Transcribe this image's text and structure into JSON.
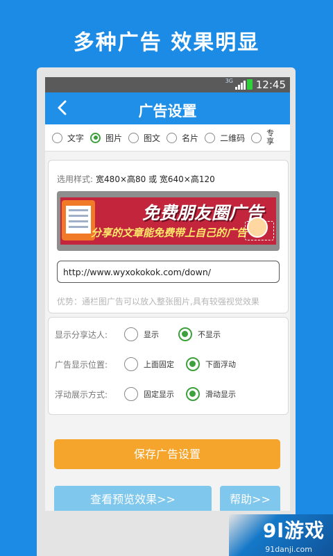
{
  "promo": {
    "title": "多种广告  效果明显"
  },
  "statusbar": {
    "network": "3G",
    "time": "12:45",
    "battery_color": "#2fd13a"
  },
  "appbar": {
    "title": "广告设置"
  },
  "ad_types": [
    {
      "label": "文字",
      "selected": false
    },
    {
      "label": "图片",
      "selected": true
    },
    {
      "label": "图文",
      "selected": false
    },
    {
      "label": "名片",
      "selected": false
    },
    {
      "label": "二维码",
      "selected": false
    },
    {
      "label": "专享",
      "selected": false
    }
  ],
  "image_card": {
    "style_label": "选用样式:",
    "style_value": "宽480×高80 或 宽640×高120",
    "banner_title": "免费朋友圈广告",
    "banner_subtitle": "分享的文章能免费带上自己的广告",
    "url_value": "http://www.wyxokokok.com/down/",
    "hint": "优势：通栏图广告可以放入整张图片,具有较强视觉效果"
  },
  "display_options": [
    {
      "label": "显示分享达人:",
      "options": [
        "显示",
        "不显示"
      ],
      "selected": 1
    },
    {
      "label": "广告显示位置:",
      "options": [
        "上面固定",
        "下面浮动"
      ],
      "selected": 1
    },
    {
      "label": "浮动展示方式:",
      "options": [
        "固定显示",
        "滑动显示"
      ],
      "selected": 1
    }
  ],
  "buttons": {
    "save": "保存广告设置",
    "preview": "查看预览效果>>",
    "help": "帮助>>"
  },
  "watermark": {
    "logo": "9l游戏",
    "url": "91danji.com"
  },
  "colors": {
    "background": "#1b8be6",
    "appbar": "#1f8fe8",
    "selected_radio": "#3ca13c",
    "save_button": "#f5a52c",
    "secondary_button": "#7fc7ec"
  }
}
